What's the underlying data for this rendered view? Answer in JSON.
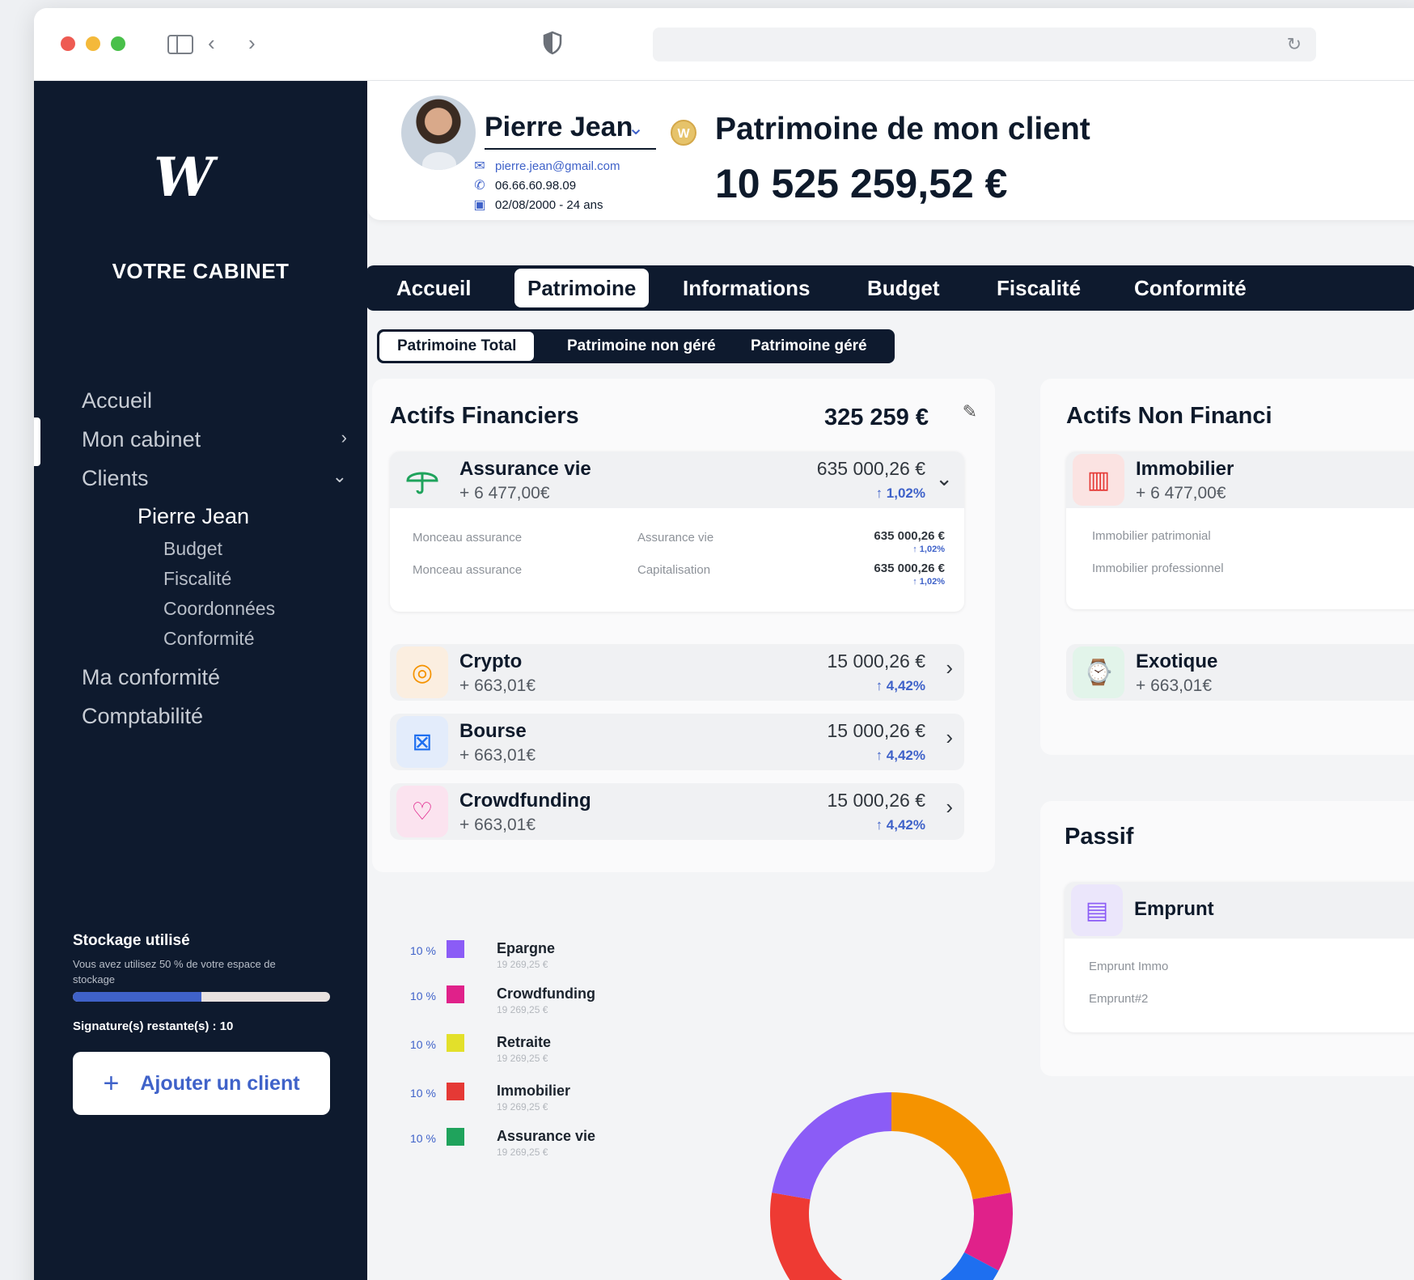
{
  "sidebar": {
    "logo": "W",
    "cabinet": "VOTRE CABINET",
    "nav": [
      "Accueil",
      "Mon cabinet",
      "Clients"
    ],
    "client_name": "Pierre Jean",
    "client_sub": [
      "Budget",
      "Fiscalité",
      "Coordonnées",
      "Conformité"
    ],
    "nav_bottom": [
      "Ma conformité",
      "Comptabilité"
    ],
    "storage_title": "Stockage utilisé",
    "storage_desc": "Vous avez utilisez 50 % de votre espace de stockage",
    "storage_used": 0.5,
    "signatures": "Signature(s) restante(s) : 10",
    "add_client": "Ajouter un client"
  },
  "client": {
    "name": "Pierre Jean",
    "badge": "W",
    "email": "pierre.jean@gmail.com",
    "phone": "06.66.60.98.09",
    "birth": "02/08/2000 - 24 ans"
  },
  "header": {
    "title": "Patrimoine de mon client",
    "total": "10 525 259,52 €"
  },
  "tabs": [
    "Accueil",
    "Patrimoine",
    "Informations",
    "Budget",
    "Fiscalité",
    "Conformité"
  ],
  "subtabs": [
    "Patrimoine Total",
    "Patrimoine non géré",
    "Patrimoine géré"
  ],
  "financial": {
    "title": "Actifs Financiers",
    "total": "325 259 €",
    "assurance": {
      "name": "Assurance vie",
      "gain": "+ 6 477,00€",
      "value": "635 000,26 €",
      "perf": "↑ 1,02%",
      "details": [
        {
          "label": "Monceau assurance",
          "type": "Assurance vie",
          "value": "635 000,26 €",
          "perf": "↑ 1,02%"
        },
        {
          "label": "Monceau assurance",
          "type": "Capitalisation",
          "value": "635 000,26 €",
          "perf": "↑ 1,02%"
        }
      ]
    },
    "items": [
      {
        "name": "Crypto",
        "gain": "+ 663,01€",
        "value": "15 000,26 €",
        "perf": "↑ 4,42%"
      },
      {
        "name": "Bourse",
        "gain": "+ 663,01€",
        "value": "15 000,26 €",
        "perf": "↑ 4,42%"
      },
      {
        "name": "Crowdfunding",
        "gain": "+ 663,01€",
        "value": "15 000,26 €",
        "perf": "↑ 4,42%"
      }
    ]
  },
  "nonfinancial": {
    "title": "Actifs Non Financi",
    "immobilier": {
      "name": "Immobilier",
      "gain": "+ 6 477,00€",
      "details": [
        "Immobilier patrimonial",
        "Immobilier professionnel"
      ]
    },
    "exotique": {
      "name": "Exotique",
      "gain": "+ 663,01€"
    }
  },
  "passif": {
    "title": "Passif",
    "emprunt": {
      "name": "Emprunt",
      "details": [
        "Emprunt Immo",
        "Emprunt#2"
      ]
    }
  },
  "legend": [
    {
      "pct": "10 %",
      "name": "Epargne",
      "sub": "19 269,25 €",
      "color": "#8b5cf6"
    },
    {
      "pct": "10 %",
      "name": "Crowdfunding",
      "sub": "19 269,25 €",
      "color": "#e0218a"
    },
    {
      "pct": "10 %",
      "name": "Retraite",
      "sub": "19 269,25 €",
      "color": "#e3e02a"
    },
    {
      "pct": "10 %",
      "name": "Immobilier",
      "sub": "19 269,25 €",
      "color": "#e53935"
    },
    {
      "pct": "10 %",
      "name": "Assurance vie",
      "sub": "19 269,25 €",
      "color": "#1fa35c"
    }
  ],
  "colors": {
    "sidebar": "#0e1a2e",
    "accent": "#3f62c9",
    "donut": [
      "#f59300",
      "#e0218a",
      "#1e6ff0",
      "#ee3a33",
      "#8b5cf6"
    ]
  }
}
